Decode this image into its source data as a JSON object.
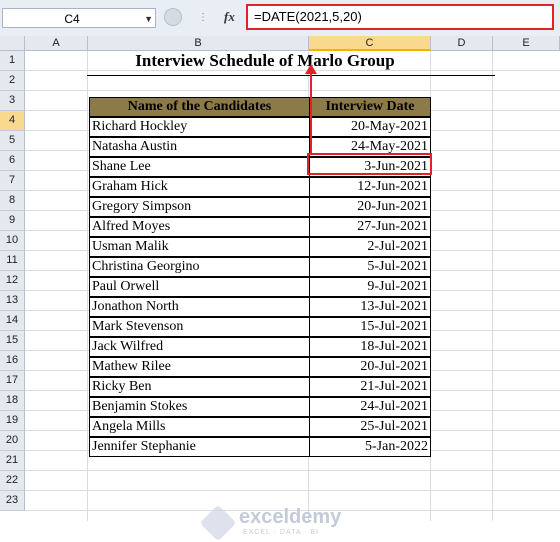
{
  "formula_bar": {
    "name_box": "C4",
    "fx_label": "fx",
    "formula": "=DATE(2021,5,20)"
  },
  "columns": [
    "A",
    "B",
    "C",
    "D",
    "E"
  ],
  "selected_column": "C",
  "rows": [
    "1",
    "2",
    "3",
    "4",
    "5",
    "6",
    "7",
    "8",
    "9",
    "10",
    "11",
    "12",
    "13",
    "14",
    "15",
    "16",
    "17",
    "18",
    "19",
    "20",
    "21",
    "22",
    "23"
  ],
  "selected_row": "4",
  "sheet": {
    "title": "Interview Schedule of Marlo Group",
    "table": {
      "headers": [
        "Name of the Candidates",
        "Interview Date"
      ],
      "rows": [
        [
          "Richard Hockley",
          "20-May-2021"
        ],
        [
          "Natasha Austin",
          "24-May-2021"
        ],
        [
          "Shane Lee",
          "3-Jun-2021"
        ],
        [
          "Graham Hick",
          "12-Jun-2021"
        ],
        [
          "Gregory Simpson",
          "20-Jun-2021"
        ],
        [
          "Alfred Moyes",
          "27-Jun-2021"
        ],
        [
          "Usman Malik",
          "2-Jul-2021"
        ],
        [
          "Christina Georgino",
          "5-Jul-2021"
        ],
        [
          "Paul Orwell",
          "9-Jul-2021"
        ],
        [
          "Jonathon North",
          "13-Jul-2021"
        ],
        [
          "Mark Stevenson",
          "15-Jul-2021"
        ],
        [
          "Jack Wilfred",
          "18-Jul-2021"
        ],
        [
          "Mathew Rilee",
          "20-Jul-2021"
        ],
        [
          "Ricky Ben",
          "21-Jul-2021"
        ],
        [
          "Benjamin Stokes",
          "24-Jul-2021"
        ],
        [
          "Angela Mills",
          "25-Jul-2021"
        ],
        [
          "Jennifer Stephanie",
          "5-Jan-2022"
        ]
      ]
    },
    "header_fill": "#8c7a48"
  },
  "watermark": {
    "brand": "exceldemy",
    "tagline": "EXCEL · DATA · BI"
  },
  "colors": {
    "highlight": "#e32127",
    "selected_header": "#f8d98e"
  }
}
